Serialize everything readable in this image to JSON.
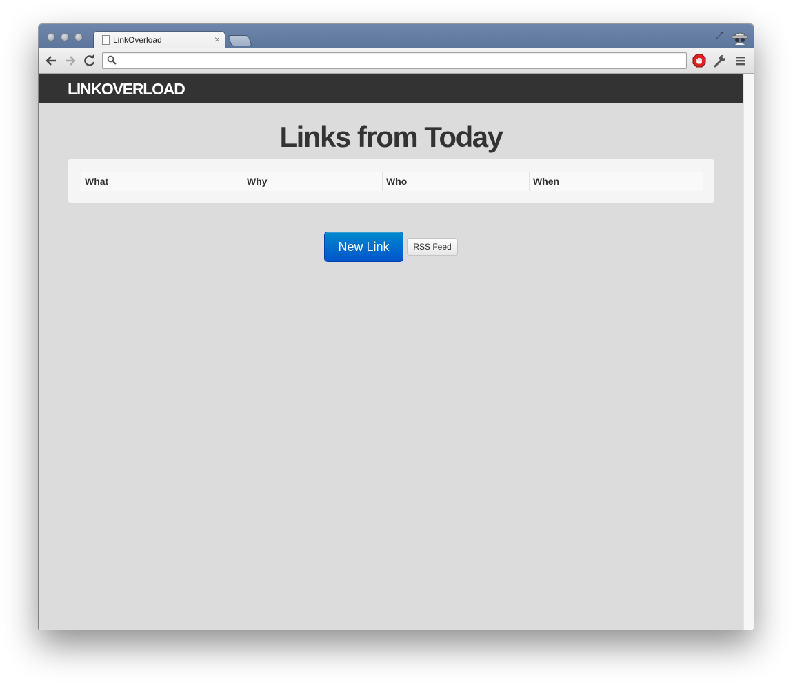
{
  "browser": {
    "tab_title": "LinkOverload",
    "tab_close": "×",
    "address": "",
    "address_placeholder": ""
  },
  "navbar": {
    "brand": "LINKOVERLOAD"
  },
  "main": {
    "title": "Links from Today",
    "table": {
      "columns": [
        "What",
        "Why",
        "Who",
        "When"
      ]
    },
    "buttons": {
      "new_link": "New Link",
      "rss_feed": "RSS Feed"
    }
  },
  "colors": {
    "primary": "#0066cc",
    "navbar": "#333333",
    "page_bg": "#dcdcdc",
    "titlebar": "#667ea5"
  },
  "icons": [
    "back-icon",
    "forward-icon",
    "reload-icon",
    "search-icon",
    "adblock-icon",
    "wrench-icon",
    "menu-icon",
    "fullscreen-icon",
    "incognito-icon",
    "page-icon",
    "close-icon"
  ]
}
